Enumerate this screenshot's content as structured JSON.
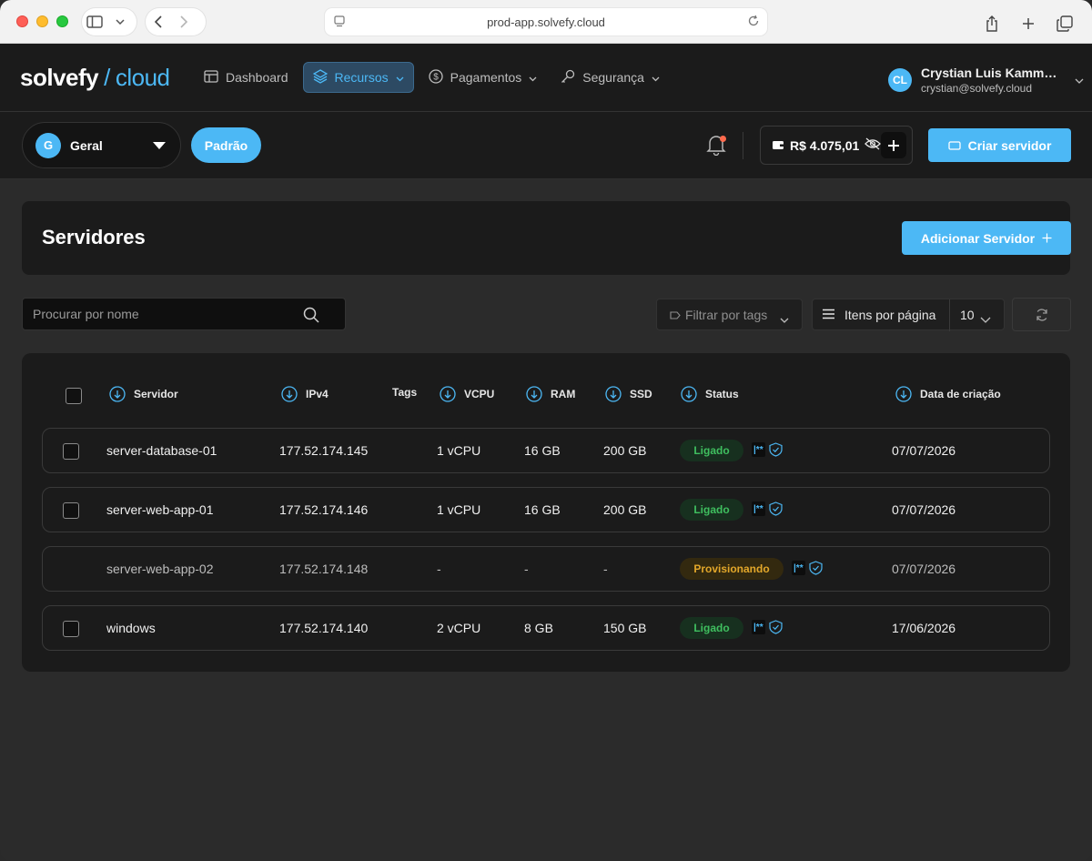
{
  "browser": {
    "url": "prod-app.solvefy.cloud"
  },
  "brand": {
    "name_part1": "solvefy",
    "slash": "/",
    "name_part2": "cloud",
    "accent": "#4cb8f5"
  },
  "nav": {
    "items": [
      {
        "label": "Dashboard",
        "icon": "dashboard-icon"
      },
      {
        "label": "Recursos",
        "icon": "layers-icon",
        "active": true
      },
      {
        "label": "Pagamentos",
        "icon": "dollar-icon"
      },
      {
        "label": "Segurança",
        "icon": "key-icon"
      }
    ]
  },
  "user": {
    "initials": "CL",
    "name": "Crystian Luis Kamm…",
    "email": "crystian@solvefy.cloud"
  },
  "subbar": {
    "project_initial": "G",
    "project_name": "Geral",
    "tag_button": "Padrão",
    "balance": "R$ 4.075,01",
    "create_server": "Criar servidor"
  },
  "page": {
    "title": "Servidores",
    "add_server": "Adicionar Servidor"
  },
  "toolbar": {
    "search_placeholder": "Procurar por nome",
    "filter_tags": "Filtrar por tags",
    "items_per_page_label": "Itens por página",
    "items_per_page_value": "10"
  },
  "table": {
    "columns": [
      "Servidor",
      "IPv4",
      "Tags",
      "VCPU",
      "RAM",
      "SSD",
      "Status",
      "Data de criação"
    ],
    "rows": [
      {
        "name": "server-database-01",
        "ip": "177.52.174.145",
        "vcpu": "1 vCPU",
        "ram": "16 GB",
        "ssd": "200 GB",
        "status": "Ligado",
        "status_kind": "on",
        "created": "07/07/2026"
      },
      {
        "name": "server-web-app-01",
        "ip": "177.52.174.146",
        "vcpu": "1 vCPU",
        "ram": "16 GB",
        "ssd": "200 GB",
        "status": "Ligado",
        "status_kind": "on",
        "created": "07/07/2026"
      },
      {
        "name": "server-web-app-02",
        "ip": "177.52.174.148",
        "vcpu": "-",
        "ram": "-",
        "ssd": "-",
        "status": "Provisionando",
        "status_kind": "provisioning",
        "created": "07/07/2026"
      },
      {
        "name": "windows",
        "ip": "177.52.174.140",
        "vcpu": "2 vCPU",
        "ram": "8 GB",
        "ssd": "150 GB",
        "status": "Ligado",
        "status_kind": "on",
        "created": "17/06/2026"
      }
    ],
    "password_glyph": "|**"
  }
}
